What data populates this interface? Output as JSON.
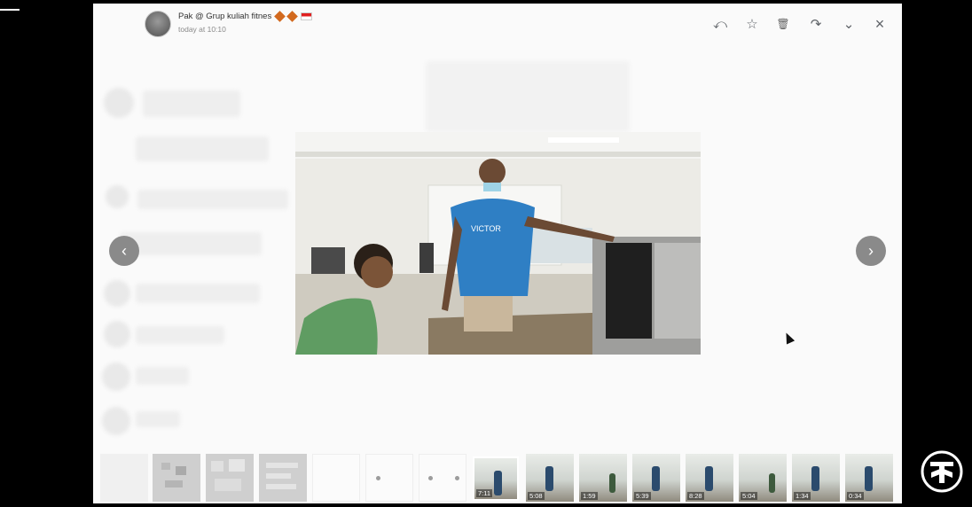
{
  "header": {
    "sender_name": "Pak @ Grup kuliah fitnes",
    "timestamp": "today at 10:10",
    "actions": [
      {
        "name": "reply-icon",
        "glyph": "⤺"
      },
      {
        "name": "star-icon",
        "glyph": "☆"
      },
      {
        "name": "delete-icon",
        "glyph": "🗑"
      },
      {
        "name": "forward-icon",
        "glyph": "↷"
      },
      {
        "name": "chevron-down-icon",
        "glyph": "⌄"
      },
      {
        "name": "close-icon",
        "glyph": "×"
      }
    ]
  },
  "media": {
    "shirt_text": "VICTOR",
    "prev_glyph": "‹",
    "next_glyph": "›"
  },
  "filmstrip": {
    "durations": [
      "7:11",
      "5:08",
      "1:59",
      "5:39",
      "8:28",
      "5:04",
      "1:34",
      "0:34"
    ]
  }
}
